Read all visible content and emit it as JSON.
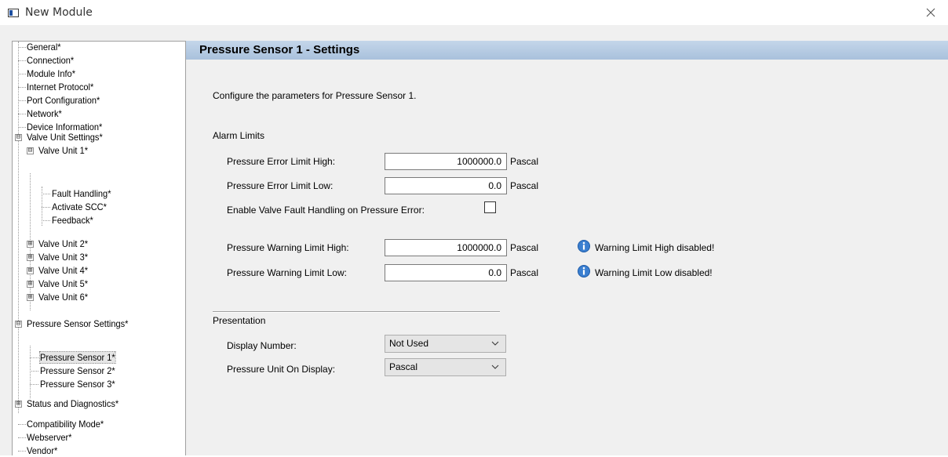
{
  "window": {
    "title": "New Module",
    "icon": "module-window-icon",
    "close_icon": "close-icon"
  },
  "tree": {
    "items": [
      {
        "label": "General*"
      },
      {
        "label": "Connection*"
      },
      {
        "label": "Module Info*"
      },
      {
        "label": "Internet Protocol*"
      },
      {
        "label": "Port Configuration*"
      },
      {
        "label": "Network*"
      },
      {
        "label": "Device Information*"
      },
      {
        "label": "Valve Unit Settings*",
        "expander": "⊟"
      },
      {
        "label": "Valve Unit 1*",
        "expander": "⊟"
      },
      {
        "label": "Fault Handling*"
      },
      {
        "label": "Activate SCC*"
      },
      {
        "label": "Feedback*"
      },
      {
        "label": "Valve Unit 2*",
        "expander": "⊞"
      },
      {
        "label": "Valve Unit 3*",
        "expander": "⊞"
      },
      {
        "label": "Valve Unit 4*",
        "expander": "⊞"
      },
      {
        "label": "Valve Unit 5*",
        "expander": "⊞"
      },
      {
        "label": "Valve Unit 6*",
        "expander": "⊞"
      },
      {
        "label": "Pressure Sensor Settings*",
        "expander": "⊟"
      },
      {
        "label": "Pressure Sensor 1*",
        "selected": true
      },
      {
        "label": "Pressure Sensor 2*"
      },
      {
        "label": "Pressure Sensor 3*"
      },
      {
        "label": "Status and Diagnostics*",
        "expander": "⊞"
      },
      {
        "label": "Compatibility Mode*"
      },
      {
        "label": "Webserver*"
      },
      {
        "label": "Vendor*"
      }
    ]
  },
  "panel": {
    "title": "Pressure Sensor 1 - Settings",
    "description": "Configure the parameters for Pressure Sensor 1.",
    "alarm_limits": {
      "heading": "Alarm Limits",
      "error_high": {
        "label": "Pressure Error Limit High:",
        "value": "1000000.0",
        "unit": "Pascal"
      },
      "error_low": {
        "label": "Pressure Error Limit Low:",
        "value": "0.0",
        "unit": "Pascal"
      },
      "enable_fault": {
        "label": "Enable Valve Fault Handling on Pressure Error:",
        "checked": false
      },
      "warning_high": {
        "label": "Pressure Warning Limit High:",
        "value": "1000000.0",
        "unit": "Pascal",
        "note": "Warning Limit High disabled!",
        "note_icon": "info-icon"
      },
      "warning_low": {
        "label": "Pressure Warning Limit Low:",
        "value": "0.0",
        "unit": "Pascal",
        "note": "Warning Limit Low disabled!",
        "note_icon": "info-icon"
      }
    },
    "presentation": {
      "heading": "Presentation",
      "display_number": {
        "label": "Display Number:",
        "value": "Not Used"
      },
      "pressure_unit": {
        "label": "Pressure Unit On Display:",
        "value": "Pascal"
      }
    }
  },
  "colors": {
    "header_bar": "#b8cde3",
    "panel_bg": "#f0f0f0",
    "info_icon": "#2a6cc4"
  }
}
